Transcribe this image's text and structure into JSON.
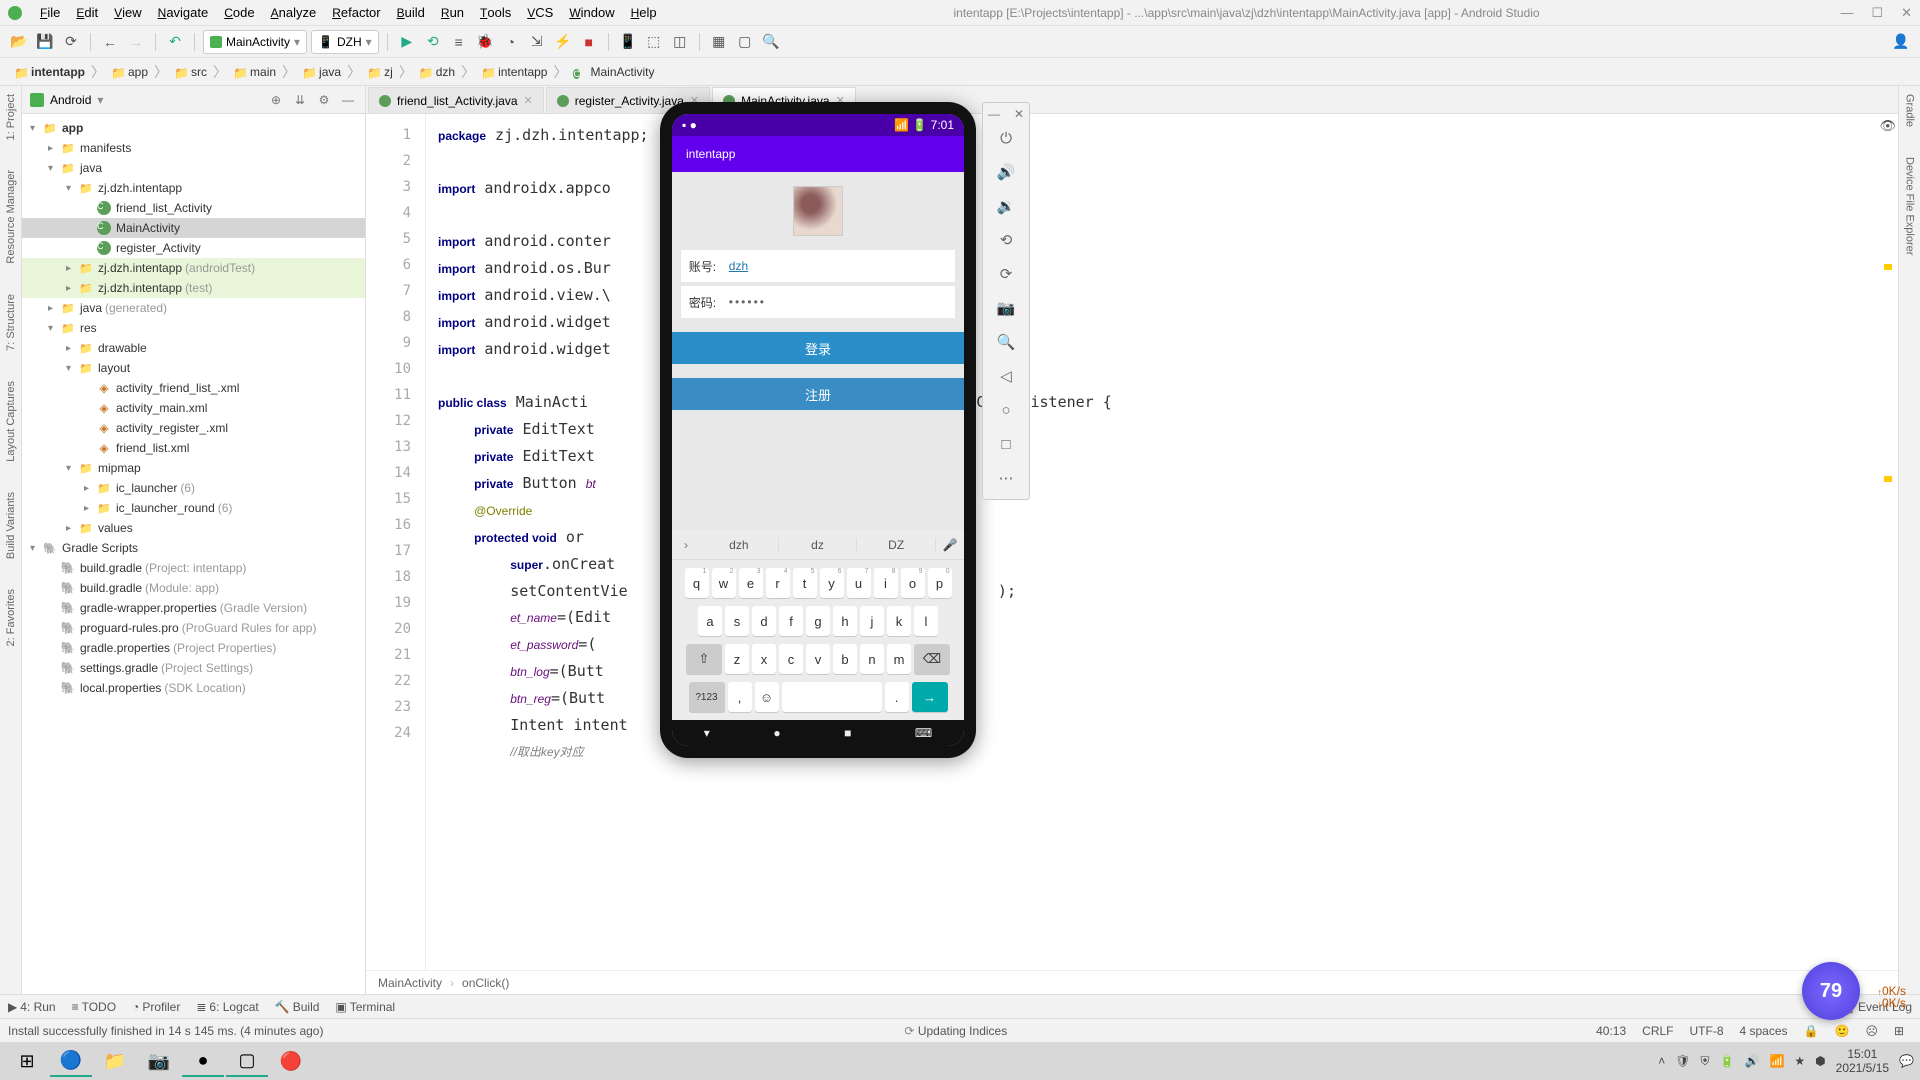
{
  "menubar": {
    "items": [
      "File",
      "Edit",
      "View",
      "Navigate",
      "Code",
      "Analyze",
      "Refactor",
      "Build",
      "Run",
      "Tools",
      "VCS",
      "Window",
      "Help"
    ],
    "title": "intentapp [E:\\Projects\\intentapp] - ...\\app\\src\\main\\java\\zj\\dzh\\intentapp\\MainActivity.java [app] - Android Studio"
  },
  "toolbar": {
    "config_label": "MainActivity",
    "device_label": "DZH"
  },
  "breadcrumb": [
    "intentapp",
    "app",
    "src",
    "main",
    "java",
    "zj",
    "dzh",
    "intentapp",
    "MainActivity"
  ],
  "project": {
    "header": "Android",
    "tree": [
      {
        "d": 0,
        "a": "v",
        "i": "📁",
        "t": "app",
        "bold": true
      },
      {
        "d": 1,
        "a": ">",
        "i": "📁",
        "t": "manifests"
      },
      {
        "d": 1,
        "a": "v",
        "i": "📁",
        "t": "java"
      },
      {
        "d": 2,
        "a": "v",
        "i": "📁",
        "t": "zj.dzh.intentapp"
      },
      {
        "d": 3,
        "a": " ",
        "i": "C",
        "t": "friend_list_Activity",
        "cls": true
      },
      {
        "d": 3,
        "a": " ",
        "i": "C",
        "t": "MainActivity",
        "cls": true,
        "sel": true
      },
      {
        "d": 3,
        "a": " ",
        "i": "C",
        "t": "register_Activity",
        "cls": true
      },
      {
        "d": 2,
        "a": ">",
        "i": "📁",
        "t": "zj.dzh.intentapp",
        "g": "(androidTest)",
        "hl": true
      },
      {
        "d": 2,
        "a": ">",
        "i": "📁",
        "t": "zj.dzh.intentapp",
        "g": "(test)",
        "hl": true
      },
      {
        "d": 1,
        "a": ">",
        "i": "📁",
        "t": "java",
        "g": "(generated)"
      },
      {
        "d": 1,
        "a": "v",
        "i": "📁",
        "t": "res"
      },
      {
        "d": 2,
        "a": ">",
        "i": "📁",
        "t": "drawable"
      },
      {
        "d": 2,
        "a": "v",
        "i": "📁",
        "t": "layout"
      },
      {
        "d": 3,
        "a": " ",
        "i": "x",
        "t": "activity_friend_list_.xml"
      },
      {
        "d": 3,
        "a": " ",
        "i": "x",
        "t": "activity_main.xml"
      },
      {
        "d": 3,
        "a": " ",
        "i": "x",
        "t": "activity_register_.xml"
      },
      {
        "d": 3,
        "a": " ",
        "i": "x",
        "t": "friend_list.xml"
      },
      {
        "d": 2,
        "a": "v",
        "i": "📁",
        "t": "mipmap"
      },
      {
        "d": 3,
        "a": ">",
        "i": "📁",
        "t": "ic_launcher",
        "g": "(6)"
      },
      {
        "d": 3,
        "a": ">",
        "i": "📁",
        "t": "ic_launcher_round",
        "g": "(6)"
      },
      {
        "d": 2,
        "a": ">",
        "i": "📁",
        "t": "values"
      },
      {
        "d": 0,
        "a": "v",
        "i": "🐘",
        "t": "Gradle Scripts"
      },
      {
        "d": 1,
        "a": " ",
        "i": "g",
        "t": "build.gradle",
        "g": "(Project: intentapp)"
      },
      {
        "d": 1,
        "a": " ",
        "i": "g",
        "t": "build.gradle",
        "g": "(Module: app)"
      },
      {
        "d": 1,
        "a": " ",
        "i": "g",
        "t": "gradle-wrapper.properties",
        "g": "(Gradle Version)"
      },
      {
        "d": 1,
        "a": " ",
        "i": "g",
        "t": "proguard-rules.pro",
        "g": "(ProGuard Rules for app)"
      },
      {
        "d": 1,
        "a": " ",
        "i": "g",
        "t": "gradle.properties",
        "g": "(Project Properties)"
      },
      {
        "d": 1,
        "a": " ",
        "i": "g",
        "t": "settings.gradle",
        "g": "(Project Settings)"
      },
      {
        "d": 1,
        "a": " ",
        "i": "g",
        "t": "local.properties",
        "g": "(SDK Location)"
      }
    ]
  },
  "tabs": [
    {
      "label": "friend_list_Activity.java"
    },
    {
      "label": "register_Activity.java"
    },
    {
      "label": "MainActivity.java",
      "active": true
    }
  ],
  "code_lines": [
    "1",
    "2",
    "3",
    "4",
    "5",
    "6",
    "7",
    "8",
    "9",
    "10",
    "11",
    "12",
    "13",
    "14",
    "15",
    "16",
    "17",
    "18",
    "19",
    "20",
    "21",
    "22",
    "23",
    "24"
  ],
  "code_html": "<span class='kw'>package</span> zj.dzh.intentapp;\n\n<span class='kw'>import</span> androidx.appco\n\n<span class='kw'>import</span> android.conter\n<span class='kw'>import</span> android.os.Bur\n<span class='kw'>import</span> android.view.\\\n<span class='kw'>import</span> android.widget\n<span class='kw'>import</span> android.widget\n\n<span class='kw'>public class</span> MainActi                               ents View.OnClickListener {\n    <span class='kw'>private</span> EditText \n    <span class='kw'>private</span> EditText \n    <span class='kw'>private</span> Button <span class='fld'>bt</span>\n    <span class='ann'>@Override</span>\n    <span class='kw'>protected void</span> or                                    ) {\n        <span class='kw'>super</span>.onCreat\n        setContentVie                                         );\n        <span class='fld'>et_name</span>=(Edit                                   );\n        <span class='fld'>et_password</span>=(                              <span class='fld'>ssword</span>);\n        <span class='fld'>btn_log</span>=(Butt                                 );\n        <span class='fld'>btn_reg</span>=(Butt                                r);\n        Intent intent\n        <span class='cmt'>//取出key对应</span>",
  "editor_crumb": [
    "MainActivity",
    "onClick()"
  ],
  "bottombar": {
    "run": "4: Run",
    "todo": "TODO",
    "profiler": "Profiler",
    "logcat": "6: Logcat",
    "build": "Build",
    "terminal": "Terminal",
    "eventlog": "Event Log"
  },
  "statusbar": {
    "msg": "Install successfully finished in 14 s 145 ms. (4 minutes ago)",
    "updating": "Updating Indices",
    "pos": "40:13",
    "eol": "CRLF",
    "enc": "UTF-8",
    "indent": "4 spaces"
  },
  "phone": {
    "time": "7:01",
    "appname": "intentapp",
    "account_label": "账号:",
    "account_value": "dzh",
    "password_label": "密码:",
    "password_value": "••••••",
    "login": "登录",
    "register": "注册",
    "suggestions": [
      "dzh",
      "dz",
      "DZ"
    ],
    "row1": [
      "q",
      "w",
      "e",
      "r",
      "t",
      "y",
      "u",
      "i",
      "o",
      "p"
    ],
    "row1n": [
      "1",
      "2",
      "3",
      "4",
      "5",
      "6",
      "7",
      "8",
      "9",
      "0"
    ],
    "row2": [
      "a",
      "s",
      "d",
      "f",
      "g",
      "h",
      "j",
      "k",
      "l"
    ],
    "row3": [
      "z",
      "x",
      "c",
      "v",
      "b",
      "n",
      "m"
    ],
    "numkey": "?123"
  },
  "taskbar": {
    "time": "15:01",
    "date": "2021/5/15"
  },
  "badge": "79",
  "netspeed": {
    "up": "0K/s",
    "down": "0K/s"
  },
  "leftrails": [
    "1: Project",
    "Resource Manager",
    "7: Structure",
    "Layout Captures",
    "Build Variants",
    "2: Favorites"
  ],
  "rightrails": [
    "Gradle",
    "Device File Explorer"
  ]
}
